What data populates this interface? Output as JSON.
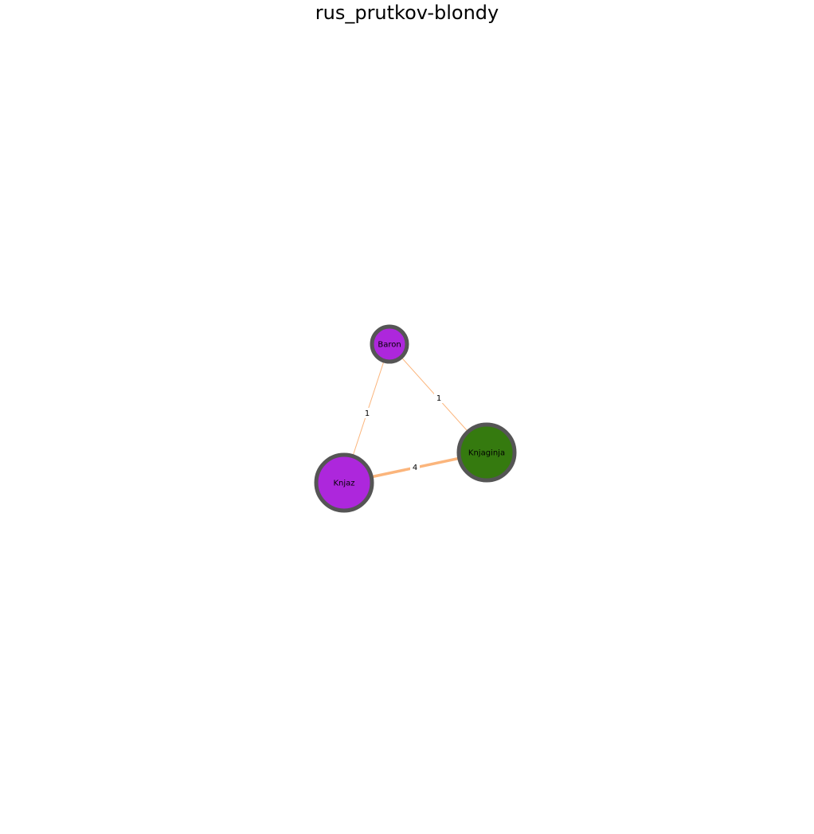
{
  "title": "rus_prutkov-blondy",
  "colors": {
    "edge": "#fbb57c",
    "node_border": "#555555",
    "label": "#000000",
    "background": "#ffffff"
  },
  "nodes": [
    {
      "id": "baron",
      "label": "Baron",
      "color": "#ad27dc"
    },
    {
      "id": "knjaginja",
      "label": "Knjaginja",
      "color": "#357a0f"
    },
    {
      "id": "knjaz",
      "label": "Knjaz",
      "color": "#ad27dc"
    }
  ],
  "edges": [
    {
      "source": "baron",
      "target": "knjaz",
      "weight": "1"
    },
    {
      "source": "baron",
      "target": "knjaginja",
      "weight": "1"
    },
    {
      "source": "knjaz",
      "target": "knjaginja",
      "weight": "4"
    }
  ]
}
